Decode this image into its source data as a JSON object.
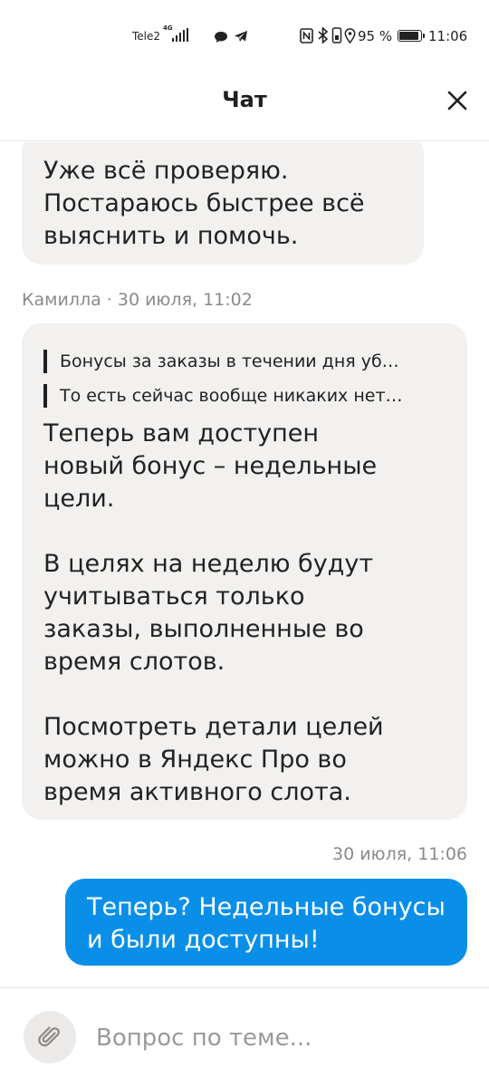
{
  "status_bar": {
    "carrier": "Tele2",
    "network": "4G",
    "battery_percent": "95 %",
    "time": "11:06"
  },
  "header": {
    "title": "Чат"
  },
  "messages": [
    {
      "direction": "incoming",
      "text": "Уже всё проверяю.\nПостараюсь быстрее всё\nвыяснить и помочь."
    },
    {
      "direction": "incoming",
      "meta": "Камилла · 30 июля, 11:02",
      "quotes": [
        "Бонусы за заказы в течении дня уб…",
        "То есть сейчас вообще никаких нет…"
      ],
      "text": "Теперь вам доступен\nновый бонус – недельные\nцели.\n\nВ целях на неделю будут\nучитываться только\nзаказы, выполненные во\nвремя слотов.\n\nПосмотреть детали целей\nможно в Яндекс Про во\nвремя активного слота."
    },
    {
      "direction": "outgoing",
      "meta": "30 июля, 11:06",
      "text": "Теперь? Недельные бонусы\nи были доступны!"
    }
  ],
  "input": {
    "placeholder": "Вопрос по теме..."
  },
  "colors": {
    "incoming_bubble": "#f2f1ef",
    "outgoing_bubble": "#0a8fe8",
    "meta_text": "#8a8a8a"
  }
}
